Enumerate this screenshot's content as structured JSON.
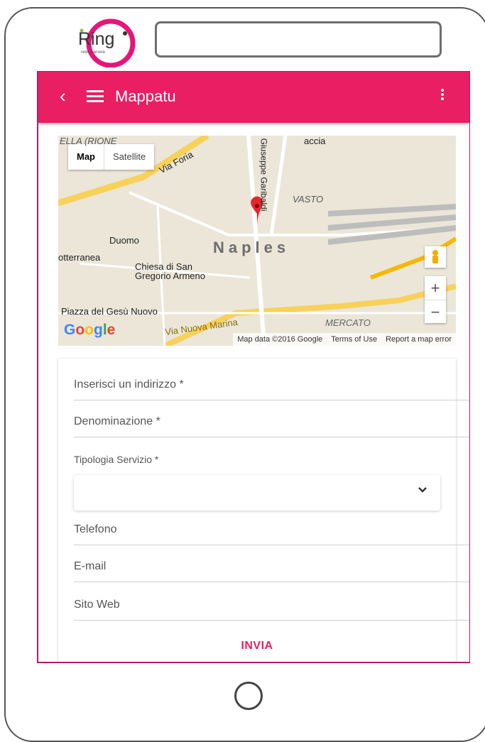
{
  "logo": {
    "text": "Ring",
    "tagline": "retinmarnere"
  },
  "app_bar": {
    "back_icon": "back-chevron-icon",
    "menu_icon": "hamburger-icon",
    "title": "Mappatu",
    "more_icon": "kebab-icon",
    "color": "#e91e63"
  },
  "map": {
    "type_buttons": [
      "Map",
      "Satellite"
    ],
    "labels": [
      "ELLA (RIONE",
      "Via Foria",
      "so Giuseppe Garibaldi",
      "VASTO",
      "Duomo",
      "otterranea",
      "Naples",
      "Chiesa di San Gregorio Armeno",
      "Piazza del Gesù Nuovo",
      "Via Nuova Marina",
      "MERCATO",
      "accia"
    ],
    "google": "Google",
    "attribution": [
      "Map data ©2016 Google",
      "Terms of Use",
      "Report a map error"
    ],
    "zoom_in": "+",
    "zoom_out": "−"
  },
  "form": {
    "address": "Inserisci un indirizzo *",
    "name": "Denominazione *",
    "service_type_label": "Tipologia Servizio *",
    "service_type_value": "",
    "phone": "Telefono",
    "email": "E-mail",
    "website": "Sito Web",
    "submit": "INVIA"
  }
}
